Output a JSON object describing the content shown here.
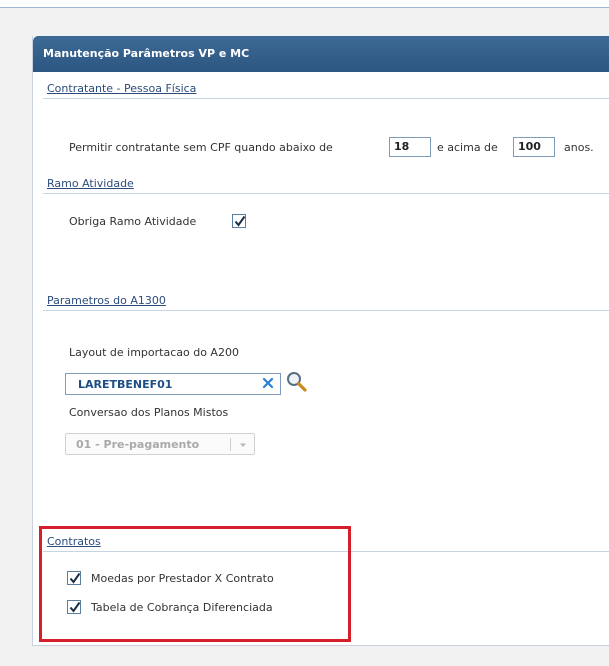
{
  "panel": {
    "title": "Manutenção Parâmetros VP e MC"
  },
  "sections": {
    "contratante": {
      "title": "Contratante - Pessoa Física",
      "sentence_prefix": "Permitir contratante sem CPF quando abaixo de",
      "min_age": "18",
      "sentence_middle": "e acima de",
      "max_age": "100",
      "sentence_suffix": "anos."
    },
    "ramo": {
      "title": "Ramo Atividade",
      "checkbox_label": "Obriga Ramo Atividade",
      "checked": true
    },
    "a1300": {
      "title": "Parametros do A1300",
      "layout_label": "Layout de importacao do A200",
      "layout_value": "LARETBENEF01",
      "conversao_label": "Conversao dos Planos Mistos",
      "conversao_value": "01 - Pre-pagamento"
    },
    "contratos": {
      "title": "Contratos",
      "option1_label": "Moedas por Prestador X Contrato",
      "option1_checked": true,
      "option2_label": "Tabela de Cobrança Diferenciada",
      "option2_checked": true
    }
  },
  "colors": {
    "header": "#2d5682",
    "link": "#2c4c7c",
    "highlight": "#d51f2b",
    "lookup_value": "#1d4f86"
  }
}
